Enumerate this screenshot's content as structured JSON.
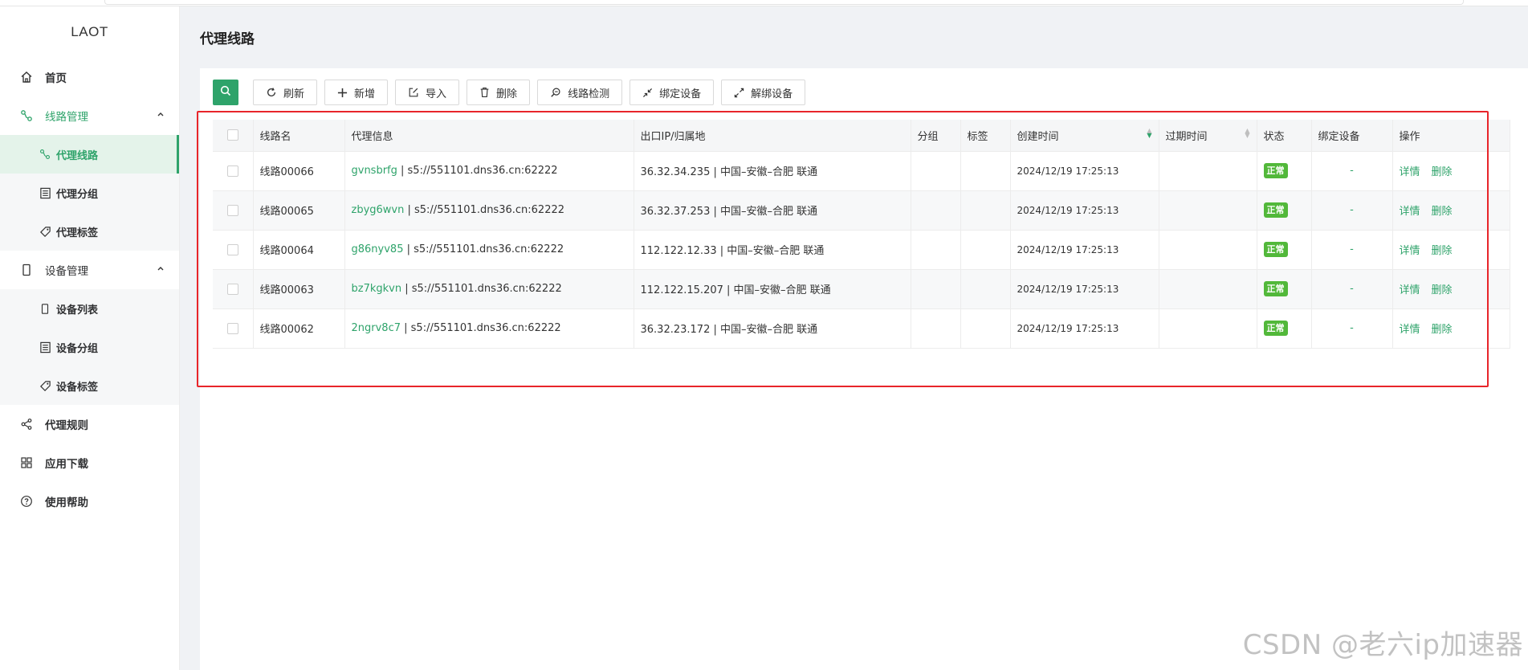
{
  "app": {
    "logo": "LAOT"
  },
  "page": {
    "title": "代理线路"
  },
  "sidebar": {
    "home": "首页",
    "route_mgmt": "线路管理",
    "route_sub": [
      {
        "label": "代理线路"
      },
      {
        "label": "代理分组"
      },
      {
        "label": "代理标签"
      }
    ],
    "device_mgmt": "设备管理",
    "device_sub": [
      {
        "label": "设备列表"
      },
      {
        "label": "设备分组"
      },
      {
        "label": "设备标签"
      }
    ],
    "rules": "代理规则",
    "download": "应用下载",
    "help": "使用帮助"
  },
  "toolbar": {
    "refresh": "刷新",
    "add": "新增",
    "import": "导入",
    "delete": "删除",
    "check": "线路检测",
    "bind": "绑定设备",
    "unbind": "解绑设备"
  },
  "table": {
    "headers": {
      "name": "线路名",
      "proxy": "代理信息",
      "exit_ip": "出口IP/归属地",
      "group": "分组",
      "tag": "标签",
      "created": "创建时间",
      "expire": "过期时间",
      "status": "状态",
      "device": "绑定设备",
      "ops": "操作"
    },
    "rows": [
      {
        "name": "线路00066",
        "user": "gvnsbrfg",
        "proxy": " | s5://551101.dns36.cn:62222",
        "exit_ip": "36.32.34.235 | 中国–安徽–合肥 联通",
        "group": "",
        "tag": "",
        "created": "2024/12/19 17:25:13",
        "expire": "",
        "status": "正常",
        "device": "-",
        "detail": "详情",
        "del": "删除"
      },
      {
        "name": "线路00065",
        "user": "zbyg6wvn",
        "proxy": " | s5://551101.dns36.cn:62222",
        "exit_ip": "36.32.37.253 | 中国–安徽–合肥 联通",
        "group": "",
        "tag": "",
        "created": "2024/12/19 17:25:13",
        "expire": "",
        "status": "正常",
        "device": "-",
        "detail": "详情",
        "del": "删除"
      },
      {
        "name": "线路00064",
        "user": "g86nyv85",
        "proxy": " | s5://551101.dns36.cn:62222",
        "exit_ip": "112.122.12.33 | 中国–安徽–合肥 联通",
        "group": "",
        "tag": "",
        "created": "2024/12/19 17:25:13",
        "expire": "",
        "status": "正常",
        "device": "-",
        "detail": "详情",
        "del": "删除"
      },
      {
        "name": "线路00063",
        "user": "bz7kgkvn",
        "proxy": " | s5://551101.dns36.cn:62222",
        "exit_ip": "112.122.15.207 | 中国–安徽–合肥 联通",
        "group": "",
        "tag": "",
        "created": "2024/12/19 17:25:13",
        "expire": "",
        "status": "正常",
        "device": "-",
        "detail": "详情",
        "del": "删除"
      },
      {
        "name": "线路00062",
        "user": "2ngrv8c7",
        "proxy": " | s5://551101.dns36.cn:62222",
        "exit_ip": "36.32.23.172 | 中国–安徽–合肥 联通",
        "group": "",
        "tag": "",
        "created": "2024/12/19 17:25:13",
        "expire": "",
        "status": "正常",
        "device": "-",
        "detail": "详情",
        "del": "删除"
      }
    ]
  },
  "colors": {
    "accent": "#2ea36a",
    "status_ok": "#52b83a",
    "highlight": "#e8252a"
  },
  "watermark": "CSDN @老六ip加速器"
}
